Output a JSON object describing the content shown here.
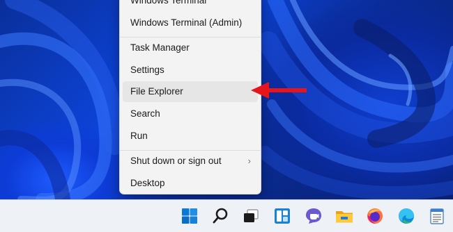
{
  "menu": {
    "items": [
      {
        "label": "Windows Terminal",
        "name": "menu-item-windows-terminal"
      },
      {
        "label": "Windows Terminal (Admin)",
        "name": "menu-item-windows-terminal-admin"
      },
      {
        "label": "Task Manager",
        "name": "menu-item-task-manager"
      },
      {
        "label": "Settings",
        "name": "menu-item-settings"
      },
      {
        "label": "File Explorer",
        "name": "menu-item-file-explorer"
      },
      {
        "label": "Search",
        "name": "menu-item-search"
      },
      {
        "label": "Run",
        "name": "menu-item-run"
      },
      {
        "label": "Shut down or sign out",
        "name": "menu-item-shut-down"
      },
      {
        "label": "Desktop",
        "name": "menu-item-desktop"
      }
    ],
    "submenu_indicator": "›",
    "highlighted": "File Explorer"
  },
  "taskbar": {
    "icons": [
      "start-icon",
      "search-icon",
      "task-view-icon",
      "widgets-icon",
      "teams-chat-icon",
      "file-explorer-icon",
      "firefox-icon",
      "edge-icon",
      "notepad-icon"
    ]
  },
  "colors": {
    "annotation_arrow": "#e8141b",
    "accent": "#0a7ad8"
  }
}
